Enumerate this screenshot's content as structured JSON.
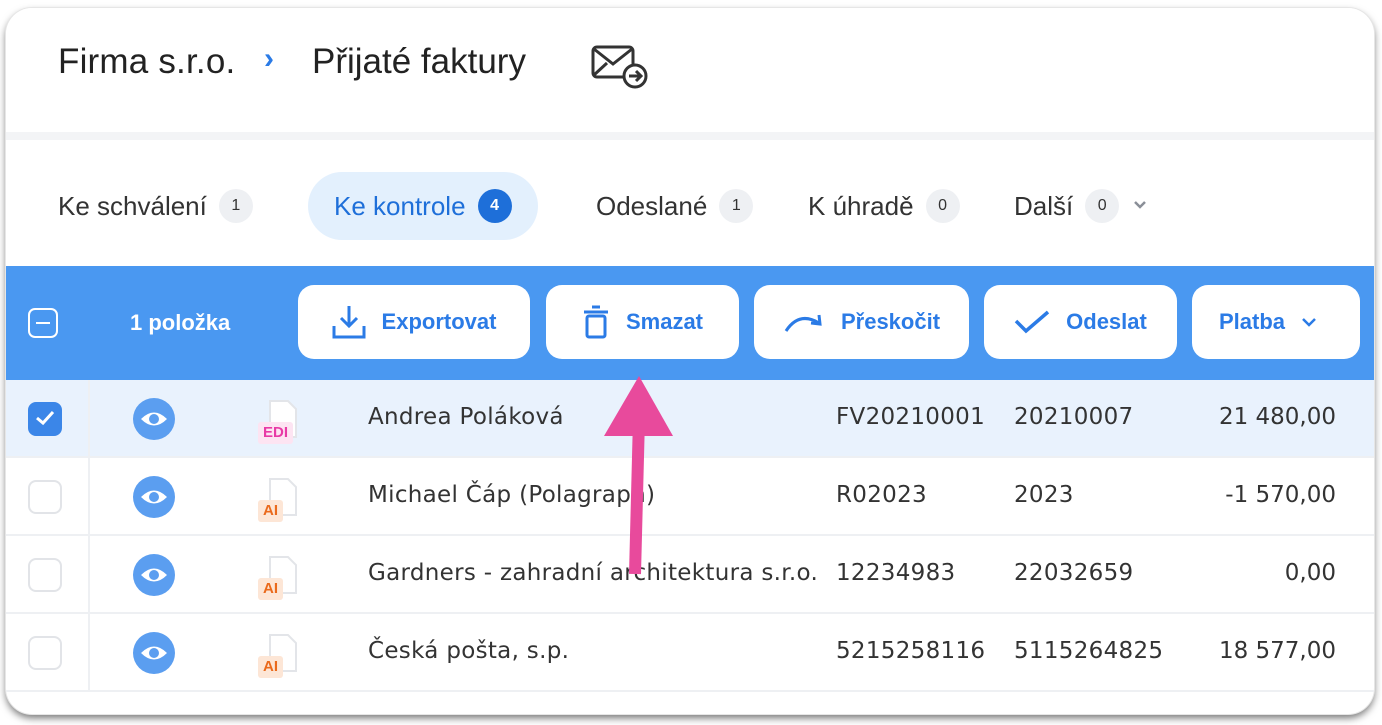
{
  "header": {
    "company": "Firma s.r.o.",
    "separator": "›",
    "title": "Přijaté faktury"
  },
  "tabs": [
    {
      "label": "Ke schválení",
      "count": "1"
    },
    {
      "label": "Ke kontrole",
      "count": "4"
    },
    {
      "label": "Odeslané",
      "count": "1"
    },
    {
      "label": "K úhradě",
      "count": "0"
    },
    {
      "label": "Další",
      "count": "0"
    }
  ],
  "toolbar": {
    "selected_count": "1 položka",
    "export_label": "Exportovat",
    "delete_label": "Smazat",
    "skip_label": "Přeskočit",
    "send_label": "Odeslat",
    "payment_label": "Platba"
  },
  "rows": [
    {
      "selected": true,
      "source": "EDI",
      "name": "Andrea Poláková",
      "doc_number": "FV20210001",
      "var_symbol": "20210007",
      "amount": "21 480,00"
    },
    {
      "selected": false,
      "source": "AI",
      "name": "Michael Čáp (Polagraph)",
      "doc_number": "R02023",
      "var_symbol": "2023",
      "amount": "-1 570,00"
    },
    {
      "selected": false,
      "source": "AI",
      "name": "Gardners - zahradní architektura s.r.o.",
      "doc_number": "12234983",
      "var_symbol": "22032659",
      "amount": "0,00"
    },
    {
      "selected": false,
      "source": "AI",
      "name": "Česká pošta, s.p.",
      "doc_number": "5215258116",
      "var_symbol": "5115264825",
      "amount": "18 577,00"
    }
  ],
  "colors": {
    "accent": "#4a98f1",
    "annotation_arrow": "#e84a9c",
    "edi_tag": "#e83aa6",
    "ai_tag": "#ea6a1c"
  },
  "icons": {
    "header": "envelope-forward-icon",
    "export": "download-icon",
    "delete": "trash-icon",
    "skip": "redo-arrow-icon",
    "send": "checkmark-icon",
    "payment": "chevron-down-icon",
    "row_preview": "eye-icon",
    "row_doc": "document-icon"
  }
}
